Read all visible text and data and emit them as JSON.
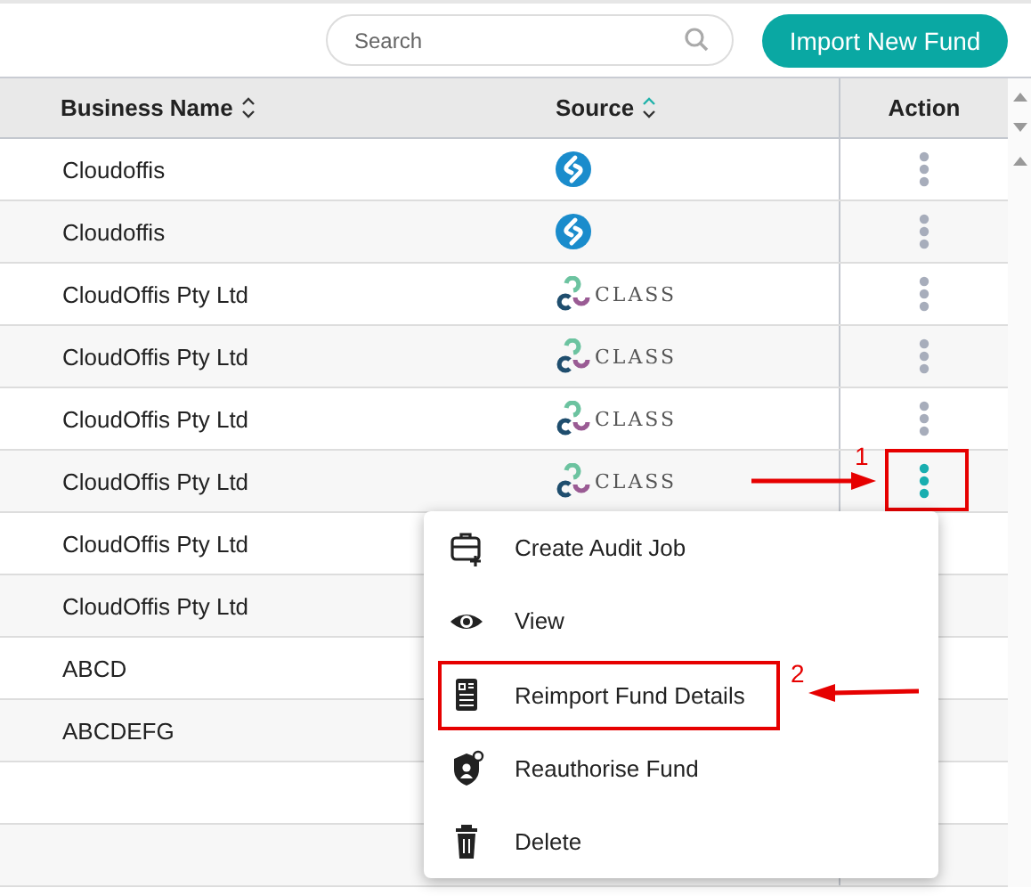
{
  "toolbar": {
    "search": {
      "placeholder": "Search"
    },
    "import_button": "Import New Fund"
  },
  "table": {
    "columns": [
      {
        "label": "Business Name",
        "sorted": false
      },
      {
        "label": "Source",
        "sorted": true
      },
      {
        "label": "Action"
      }
    ],
    "rows": [
      {
        "name": "Cloudoffis",
        "source": {
          "kind": "cloud"
        },
        "menu_open": false
      },
      {
        "name": "Cloudoffis",
        "source": {
          "kind": "cloud"
        },
        "menu_open": false
      },
      {
        "name": "CloudOffis Pty Ltd",
        "source": {
          "kind": "class",
          "label": "CLASS"
        },
        "menu_open": false
      },
      {
        "name": "CloudOffis Pty Ltd",
        "source": {
          "kind": "class",
          "label": "CLASS"
        },
        "menu_open": false
      },
      {
        "name": "CloudOffis Pty Ltd",
        "source": {
          "kind": "class",
          "label": "CLASS"
        },
        "menu_open": false
      },
      {
        "name": "CloudOffis Pty Ltd",
        "source": {
          "kind": "class",
          "label": "CLASS"
        },
        "menu_open": true,
        "callout": "1"
      },
      {
        "name": "CloudOffis Pty Ltd"
      },
      {
        "name": "CloudOffis Pty Ltd"
      },
      {
        "name": "ABCD"
      },
      {
        "name": "ABCDEFG"
      },
      {},
      {}
    ]
  },
  "action_menu": {
    "items": [
      {
        "kind": "audit",
        "label": "Create Audit Job"
      },
      {
        "kind": "view",
        "label": "View"
      },
      {
        "kind": "reimport",
        "label": "Reimport Fund Details",
        "callout": "2"
      },
      {
        "kind": "reauthorise",
        "label": "Reauthorise Fund"
      },
      {
        "kind": "delete",
        "label": "Delete"
      }
    ]
  }
}
